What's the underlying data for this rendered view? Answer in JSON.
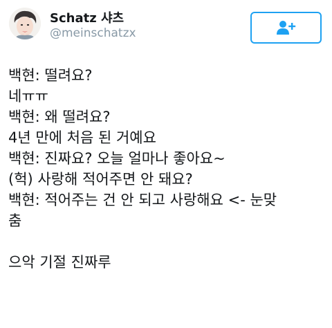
{
  "author": {
    "display_name": "Schatz 샤츠",
    "handle": "@meinschatzx",
    "avatar_icon": "profile-avatar"
  },
  "follow_button": {
    "icon": "add-user-icon",
    "color": "#1da1f2"
  },
  "tweet": {
    "lines": [
      "백현: 떨려요?",
      "네ㅠㅠ",
      "백현: 왜 떨려요?",
      "4년 만에 처음 된 거예요",
      "백현: 진짜요? 오늘 얼마나 좋아요~",
      "(헉) 사랑해 적어주면 안 돼요?",
      "백현: 적어주는 건 안 되고 사랑해요 <- 눈맞",
      "춤",
      "",
      "으악 기절 진짜루"
    ]
  },
  "colors": {
    "text": "#14171a",
    "secondary_text": "#8899a6",
    "accent": "#1da1f2"
  }
}
